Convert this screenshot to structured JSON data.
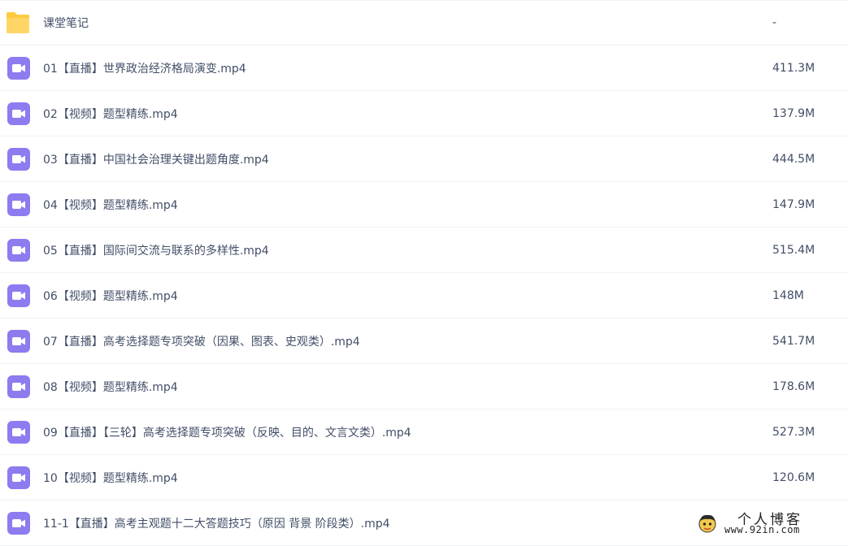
{
  "files": [
    {
      "type": "folder",
      "name": "课堂笔记",
      "size": "-"
    },
    {
      "type": "video",
      "name": "01【直播】世界政治经济格局演变.mp4",
      "size": "411.3M"
    },
    {
      "type": "video",
      "name": "02【视频】题型精练.mp4",
      "size": "137.9M"
    },
    {
      "type": "video",
      "name": "03【直播】中国社会治理关键出题角度.mp4",
      "size": "444.5M"
    },
    {
      "type": "video",
      "name": "04【视频】题型精练.mp4",
      "size": "147.9M"
    },
    {
      "type": "video",
      "name": "05【直播】国际间交流与联系的多样性.mp4",
      "size": "515.4M"
    },
    {
      "type": "video",
      "name": "06【视频】题型精练.mp4",
      "size": "148M"
    },
    {
      "type": "video",
      "name": "07【直播】高考选择题专项突破（因果、图表、史观类）.mp4",
      "size": "541.7M"
    },
    {
      "type": "video",
      "name": "08【视频】题型精练.mp4",
      "size": "178.6M"
    },
    {
      "type": "video",
      "name": "09【直播】【三轮】高考选择题专项突破（反映、目的、文言文类）.mp4",
      "size": "527.3M"
    },
    {
      "type": "video",
      "name": "10【视频】题型精练.mp4",
      "size": "120.6M"
    },
    {
      "type": "video",
      "name": "11-1【直播】高考主观题十二大答题技巧（原因 背景 阶段类）.mp4",
      "size": ""
    }
  ],
  "watermark": {
    "title": "个人博客",
    "url": "www.92in.com"
  },
  "colors": {
    "folder": "#ffc940",
    "video": "#8c7cf0",
    "text": "#424e67"
  }
}
